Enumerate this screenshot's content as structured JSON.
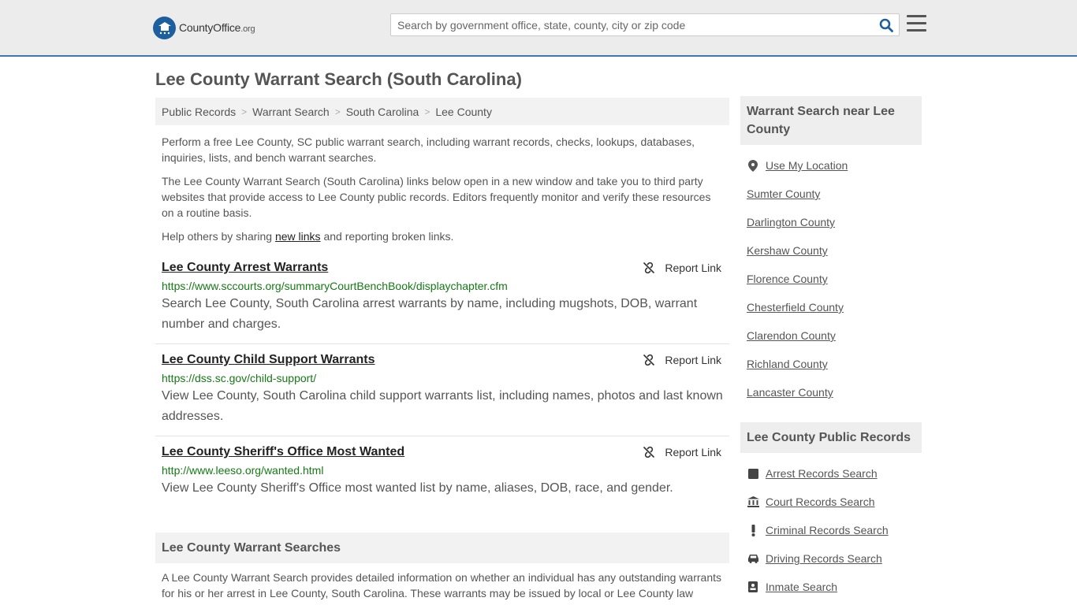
{
  "header": {
    "logo_name": "CountyOffice",
    "logo_tld": ".org",
    "search_placeholder": "Search by government office, state, county, city or zip code"
  },
  "page_title": "Lee County Warrant Search (South Carolina)",
  "breadcrumb": [
    "Public Records",
    "Warrant Search",
    "South Carolina",
    "Lee County"
  ],
  "intro": {
    "p1": "Perform a free Lee County, SC public warrant search, including warrant records, checks, lookups, databases, inquiries, lists, and bench warrant searches.",
    "p2": "The Lee County Warrant Search (South Carolina) links below open in a new window and take you to third party websites that provide access to Lee County public records. Editors frequently monitor and verify these resources on a routine basis.",
    "p3_before": "Help others by sharing ",
    "p3_link": "new links",
    "p3_after": " and reporting broken links."
  },
  "report_label": "Report Link",
  "results": [
    {
      "title": "Lee County Arrest Warrants",
      "url": "https://www.sccourts.org/summaryCourtBenchBook/displaychapter.cfm",
      "description": "Search Lee County, South Carolina arrest warrants by name, including mugshots, DOB, warrant number and charges."
    },
    {
      "title": "Lee County Child Support Warrants",
      "url": "https://dss.sc.gov/child-support/",
      "description": "View Lee County, South Carolina child support warrants list, including names, photos and last known addresses."
    },
    {
      "title": "Lee County Sheriff's Office Most Wanted",
      "url": "http://www.leeso.org/wanted.html",
      "description": "View Lee County Sheriff's Office most wanted list by name, aliases, DOB, race, and gender."
    }
  ],
  "searches_section": {
    "heading": "Lee County Warrant Searches",
    "text": "A Lee County Warrant Search provides detailed information on whether an individual has any outstanding warrants for his or her arrest in Lee County, South Carolina. These warrants may be issued by local or Lee County law"
  },
  "sidebar": {
    "nearby_heading": "Warrant Search near Lee County",
    "use_location": "Use My Location",
    "nearby": [
      "Sumter County",
      "Darlington County",
      "Kershaw County",
      "Florence County",
      "Chesterfield County",
      "Clarendon County",
      "Richland County",
      "Lancaster County"
    ],
    "records_heading": "Lee County Public Records",
    "records": [
      {
        "label": "Arrest Records Search",
        "icon": "square-icon"
      },
      {
        "label": "Court Records Search",
        "icon": "courthouse-icon"
      },
      {
        "label": "Criminal Records Search",
        "icon": "exclamation-icon"
      },
      {
        "label": "Driving Records Search",
        "icon": "car-icon"
      },
      {
        "label": "Inmate Search",
        "icon": "id-badge-icon"
      }
    ]
  },
  "colors": {
    "accent_blue": "#1d5f9e",
    "url_green": "#157a15",
    "header_bg": "#ececec",
    "header_border": "#3b78b5"
  }
}
